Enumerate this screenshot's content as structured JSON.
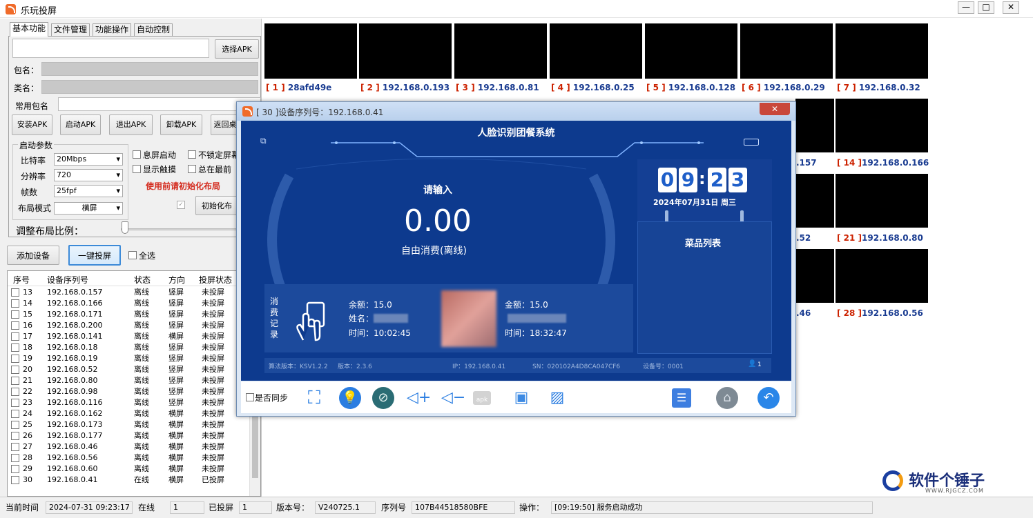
{
  "app": {
    "title": "乐玩投屏"
  },
  "window_buttons": {
    "minimize": "—",
    "maximize": "□",
    "close": "✕"
  },
  "tabs": [
    "基本功能",
    "文件管理",
    "功能操作",
    "自动控制"
  ],
  "basic": {
    "apk_path": "",
    "select_apk": "选择APK",
    "package_label": "包名：",
    "class_label": "类名：",
    "common_label": "常用包名",
    "buttons": [
      "安装APK",
      "启动APK",
      "退出APK",
      "卸载APK",
      "返回桌"
    ],
    "start_params": "启动参数",
    "bitrate_label": "比特率",
    "bitrate": "20Mbps",
    "resolution_label": "分辨率",
    "resolution": "720",
    "fps_label": "帧数",
    "fps": "25fpf",
    "layout_label": "布局模式",
    "layout": "横屏",
    "checks": [
      "息屏启动",
      "不锁定屏幕",
      "显示触摸",
      "总在最前"
    ],
    "warning": "使用前请初始化布局",
    "init_button": "初始化布",
    "ratio_label": "调整布局比例："
  },
  "actions": {
    "add_device": "添加设备",
    "one_click": "一键投屏",
    "select_all": "全选"
  },
  "table": {
    "headers": [
      "序号",
      "设备序列号",
      "状态",
      "方向",
      "投屏状态"
    ],
    "rows": [
      [
        "13",
        "192.168.0.157",
        "离线",
        "竖屏",
        "未投屏"
      ],
      [
        "14",
        "192.168.0.166",
        "离线",
        "竖屏",
        "未投屏"
      ],
      [
        "15",
        "192.168.0.171",
        "离线",
        "竖屏",
        "未投屏"
      ],
      [
        "16",
        "192.168.0.200",
        "离线",
        "竖屏",
        "未投屏"
      ],
      [
        "17",
        "192.168.0.141",
        "离线",
        "横屏",
        "未投屏"
      ],
      [
        "18",
        "192.168.0.18",
        "离线",
        "竖屏",
        "未投屏"
      ],
      [
        "19",
        "192.168.0.19",
        "离线",
        "竖屏",
        "未投屏"
      ],
      [
        "20",
        "192.168.0.52",
        "离线",
        "竖屏",
        "未投屏"
      ],
      [
        "21",
        "192.168.0.80",
        "离线",
        "竖屏",
        "未投屏"
      ],
      [
        "22",
        "192.168.0.98",
        "离线",
        "竖屏",
        "未投屏"
      ],
      [
        "23",
        "192.168.0.116",
        "离线",
        "竖屏",
        "未投屏"
      ],
      [
        "24",
        "192.168.0.162",
        "离线",
        "横屏",
        "未投屏"
      ],
      [
        "25",
        "192.168.0.173",
        "离线",
        "横屏",
        "未投屏"
      ],
      [
        "26",
        "192.168.0.177",
        "离线",
        "横屏",
        "未投屏"
      ],
      [
        "27",
        "192.168.0.46",
        "离线",
        "横屏",
        "未投屏"
      ],
      [
        "28",
        "192.168.0.56",
        "离线",
        "横屏",
        "未投屏"
      ],
      [
        "29",
        "192.168.0.60",
        "离线",
        "横屏",
        "未投屏"
      ],
      [
        "30",
        "192.168.0.41",
        "在线",
        "横屏",
        "已投屏"
      ]
    ]
  },
  "status": {
    "time_label": "当前时间",
    "time": "2024-07-31 09:23:17",
    "online_label": "在线",
    "online": "1",
    "cast_label": "已投屏",
    "cast": "1",
    "version_label": "版本号：",
    "version": "V240725.1",
    "serial_label": "序列号",
    "serial": "107B44518580BFE",
    "op_label": "操作：",
    "op": "[09:19:50] 服务启动成功"
  },
  "thumbs_row1": [
    {
      "num": "[ 1 ]",
      "name": "28afd49e"
    },
    {
      "num": "[ 2 ]",
      "name": "192.168.0.193"
    },
    {
      "num": "[ 3 ]",
      "name": "192.168.0.81"
    },
    {
      "num": "[ 4 ]",
      "name": "192.168.0.25"
    },
    {
      "num": "[ 5 ]",
      "name": "192.168.0.128"
    },
    {
      "num": "[ 6 ]",
      "name": "192.168.0.29"
    },
    {
      "num": "[ 7 ]",
      "name": "192.168.0.32"
    }
  ],
  "thumbs_side": [
    {
      "num": "",
      "name": ".157"
    },
    {
      "num": "[ 14 ]",
      "name": "192.168.0.166"
    },
    {
      "num": "",
      "name": ".52"
    },
    {
      "num": "[ 21 ]",
      "name": "192.168.0.80"
    },
    {
      "num": "",
      "name": ".46"
    },
    {
      "num": "[ 28 ]",
      "name": "192.168.0.56"
    }
  ],
  "popup": {
    "title": "[ 30 ]设备序列号：192.168.0.41",
    "close": "✕",
    "sys_title": "人脸识别团餐系统",
    "prompt": "请输入",
    "amount": "0.00",
    "mode": "自由消费(离线)",
    "clock": [
      "0",
      "9",
      "2",
      "3"
    ],
    "date": "2024年07月31日 周三",
    "menu": "菜品列表",
    "record_label": [
      "消",
      "费",
      "记",
      "录"
    ],
    "rec1": {
      "amount": "余额：15.0",
      "name": "姓名：",
      "time": "时间：10:02:45"
    },
    "rec2": {
      "amount": "金额：15.0",
      "time": "时间：18:32:47"
    },
    "footer": [
      "算法版本：KSV1.2.2",
      "版本：2.3.6",
      "IP：192.168.0.41",
      "SN：020102A4D8CA047CF6",
      "设备号：0001"
    ],
    "user_count": "1",
    "sync_label": "是否同步",
    "apk_tag": "apk"
  },
  "watermark": {
    "name": "软件个锤子",
    "url": "WWW.RJGCZ.COM"
  }
}
